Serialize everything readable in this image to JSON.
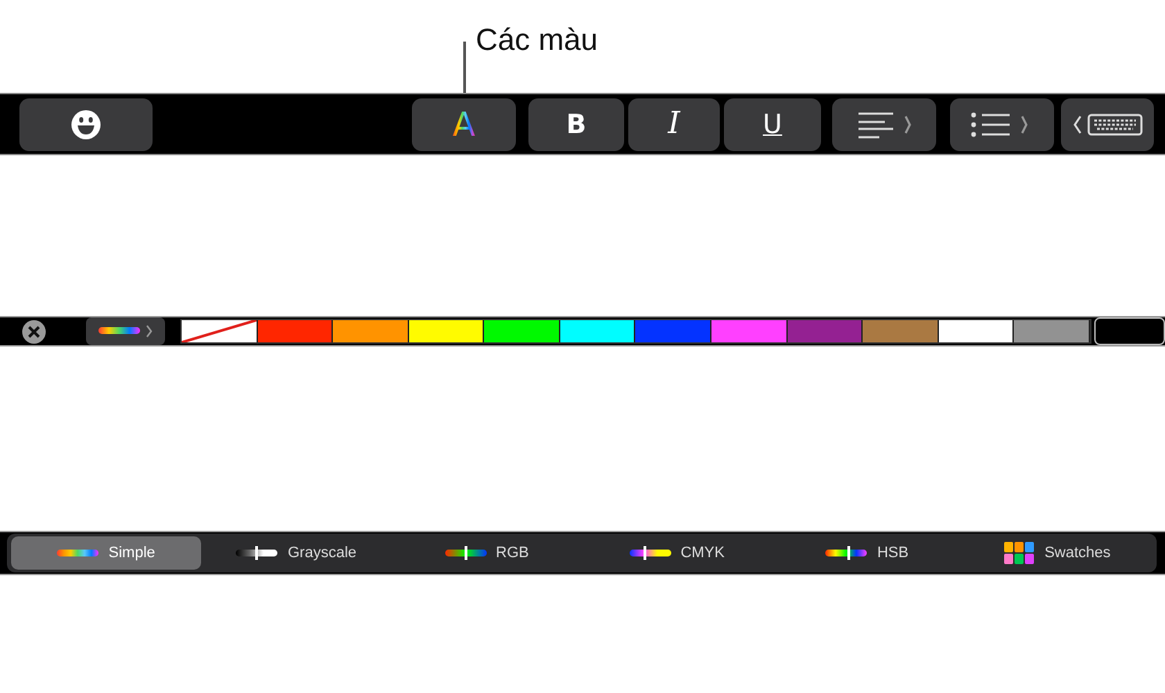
{
  "callout": {
    "label": "Các màu"
  },
  "toolbar": [
    {
      "kind": "emoji"
    },
    {
      "kind": "color",
      "label": "A"
    },
    {
      "kind": "bold",
      "label": "B"
    },
    {
      "kind": "italic",
      "label": "I"
    },
    {
      "kind": "underline",
      "label": "U"
    },
    {
      "kind": "align"
    },
    {
      "kind": "list"
    },
    {
      "kind": "keyboard"
    }
  ],
  "color_bar": {
    "swatches": [
      {
        "kind": "none",
        "selected": false
      },
      {
        "kind": "color",
        "color": "#ff2600",
        "selected": false
      },
      {
        "kind": "color",
        "color": "#ff9300",
        "selected": false
      },
      {
        "kind": "color",
        "color": "#fffb00",
        "selected": false
      },
      {
        "kind": "color",
        "color": "#00f900",
        "selected": false
      },
      {
        "kind": "color",
        "color": "#00fdff",
        "selected": false
      },
      {
        "kind": "color",
        "color": "#0433ff",
        "selected": false
      },
      {
        "kind": "color",
        "color": "#ff40ff",
        "selected": false
      },
      {
        "kind": "color",
        "color": "#942192",
        "selected": false
      },
      {
        "kind": "color",
        "color": "#aa7942",
        "selected": false
      },
      {
        "kind": "color",
        "color": "#ffffff",
        "selected": false
      },
      {
        "kind": "color",
        "color": "#929292",
        "selected": false
      },
      {
        "kind": "color",
        "color": "#000000",
        "selected": true
      }
    ]
  },
  "picker_tabs": [
    {
      "kind": "spectrum",
      "label": "Simple",
      "selected": true
    },
    {
      "kind": "grayscale",
      "label": "Grayscale",
      "selected": false
    },
    {
      "kind": "rgb",
      "label": "RGB",
      "selected": false
    },
    {
      "kind": "cmyk",
      "label": "CMYK",
      "selected": false
    },
    {
      "kind": "hsb",
      "label": "HSB",
      "selected": false
    },
    {
      "kind": "swatches",
      "label": "Swatches",
      "selected": false
    }
  ]
}
